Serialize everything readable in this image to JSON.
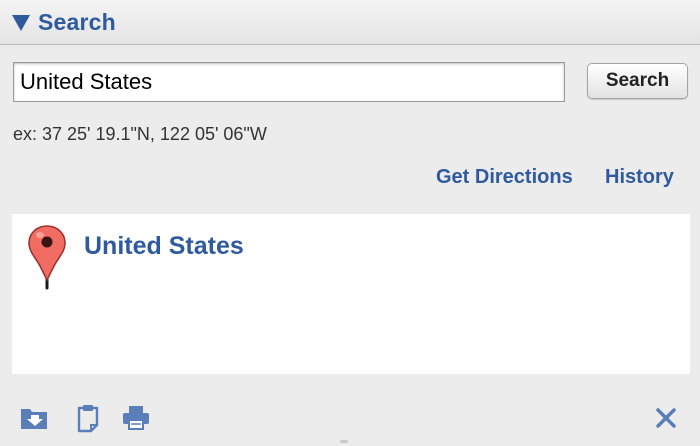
{
  "header": {
    "title": "Search"
  },
  "search": {
    "value": "United States",
    "button_label": "Search",
    "example": "ex: 37 25' 19.1\"N, 122 05' 06\"W"
  },
  "links": {
    "directions": "Get Directions",
    "history": "History"
  },
  "results": [
    {
      "title": "United States",
      "icon": "map-pin-icon"
    }
  ],
  "toolbar": {
    "icons": [
      "folder-download-icon",
      "clipboard-icon",
      "print-icon",
      "close-icon"
    ]
  },
  "colors": {
    "accent": "#2f5a9e",
    "pin": "#f16c62",
    "background": "#ececec"
  }
}
